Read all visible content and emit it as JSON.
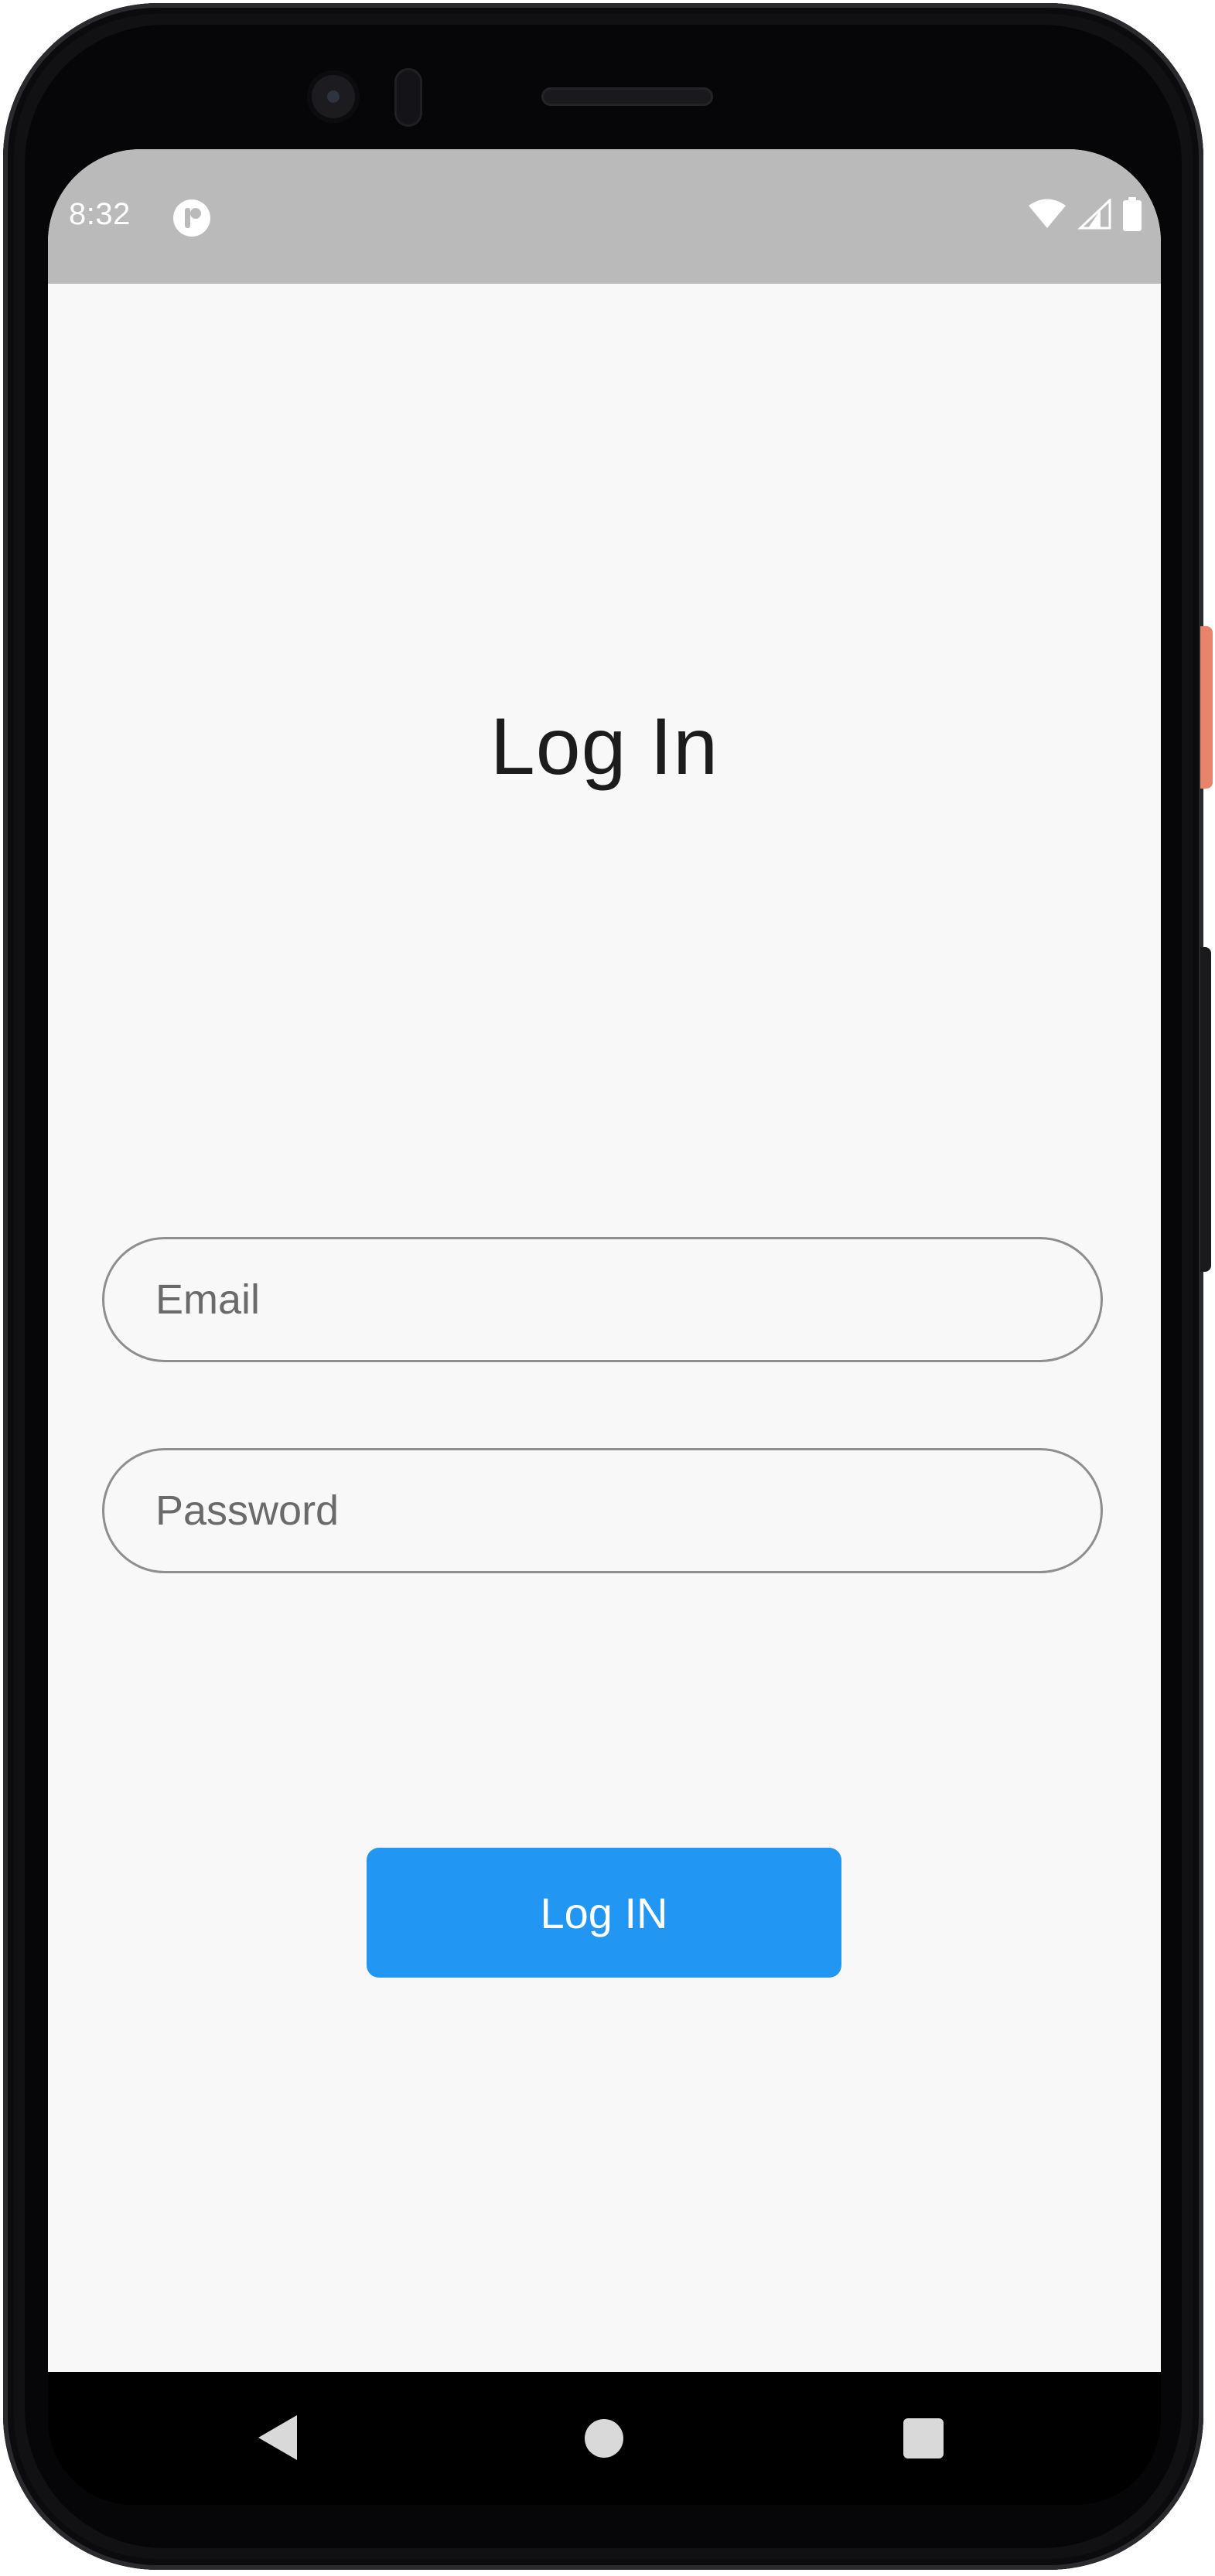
{
  "status_bar": {
    "time": "8:32",
    "notification_icon": "app-notification-icon",
    "wifi_icon": "wifi-icon",
    "signal_icon": "cellular-signal-icon",
    "battery_icon": "battery-icon"
  },
  "login": {
    "title": "Log In",
    "email_placeholder": "Email",
    "email_value": "",
    "password_placeholder": "Password",
    "password_value": "",
    "submit_label": "Log IN"
  },
  "nav_bar": {
    "back_icon": "back-triangle-icon",
    "home_icon": "home-circle-icon",
    "recents_icon": "recents-square-icon"
  },
  "colors": {
    "accent": "#2196F3",
    "status_bar_bg": "#BABABA",
    "screen_bg": "#F8F8F8",
    "title_text": "#1C1C1C",
    "field_border": "#8E8E8E"
  }
}
